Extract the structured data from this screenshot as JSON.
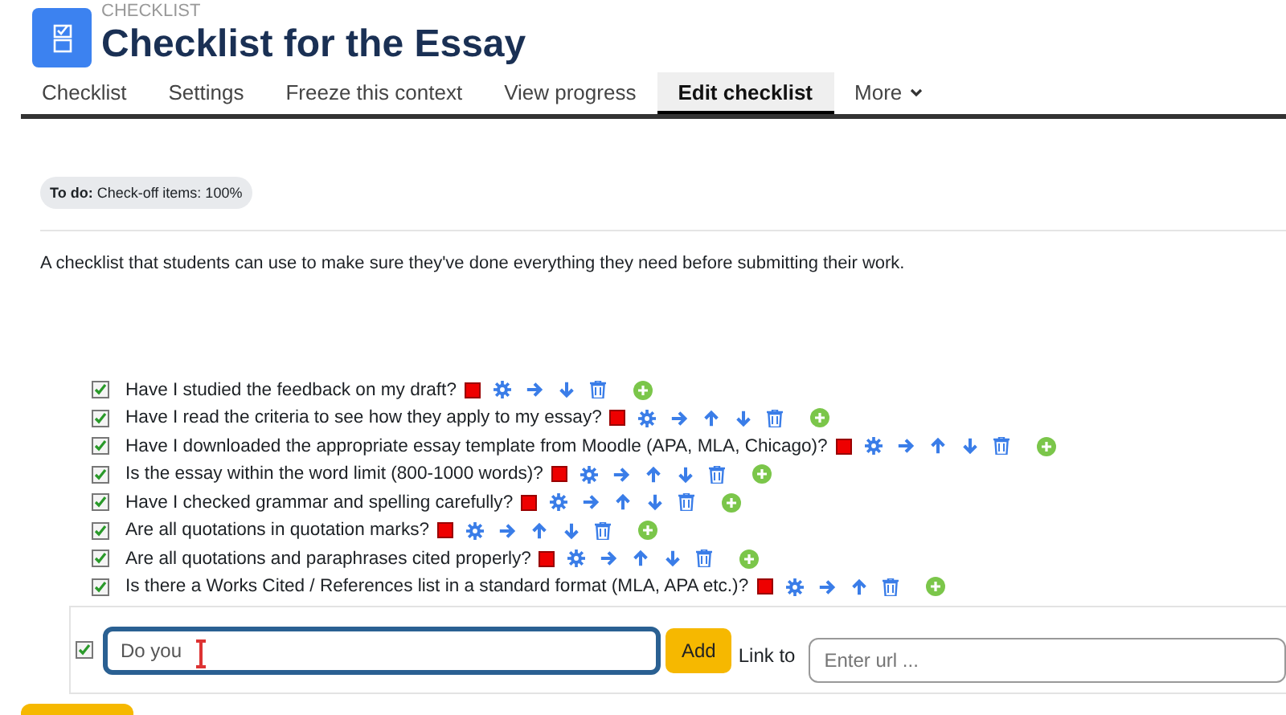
{
  "header": {
    "eyebrow": "CHECKLIST",
    "title": "Checklist for the Essay"
  },
  "tabs": [
    {
      "label": "Checklist",
      "selected": false
    },
    {
      "label": "Settings",
      "selected": false
    },
    {
      "label": "Freeze this context",
      "selected": false
    },
    {
      "label": "View progress",
      "selected": false
    },
    {
      "label": "Edit checklist",
      "selected": true
    },
    {
      "label": "More",
      "selected": false,
      "kind": "dropdown"
    }
  ],
  "badge": {
    "label": "To do:",
    "text": "Check-off items: 100%"
  },
  "description": "A checklist that students can use to make sure they've done everything they need before submitting their work.",
  "items": [
    {
      "text": "Have I studied the feedback on my draft?",
      "checked": true,
      "can_move_up": false,
      "can_move_down": true
    },
    {
      "text": "Have I read the criteria to see how they apply to my essay?",
      "checked": true,
      "can_move_up": true,
      "can_move_down": true
    },
    {
      "text": "Have I downloaded the appropriate essay template from Moodle (APA, MLA, Chicago)?",
      "checked": true,
      "can_move_up": true,
      "can_move_down": true
    },
    {
      "text": "Is the essay within the word limit (800-1000 words)?",
      "checked": true,
      "can_move_up": true,
      "can_move_down": true
    },
    {
      "text": "Have I checked grammar and spelling carefully?",
      "checked": true,
      "can_move_up": true,
      "can_move_down": true
    },
    {
      "text": "Are all quotations in quotation marks?",
      "checked": true,
      "can_move_up": true,
      "can_move_down": true
    },
    {
      "text": "Are all quotations and paraphrases cited properly?",
      "checked": true,
      "can_move_up": true,
      "can_move_down": true
    },
    {
      "text": "Is there a Works Cited / References list in a standard format (MLA, APA etc.)?",
      "checked": true,
      "can_move_up": true,
      "can_move_down": false
    }
  ],
  "new_item": {
    "checked": true,
    "value": "Do you",
    "add_button": "Add",
    "link_label": "Link to",
    "url_placeholder": "Enter url ..."
  }
}
